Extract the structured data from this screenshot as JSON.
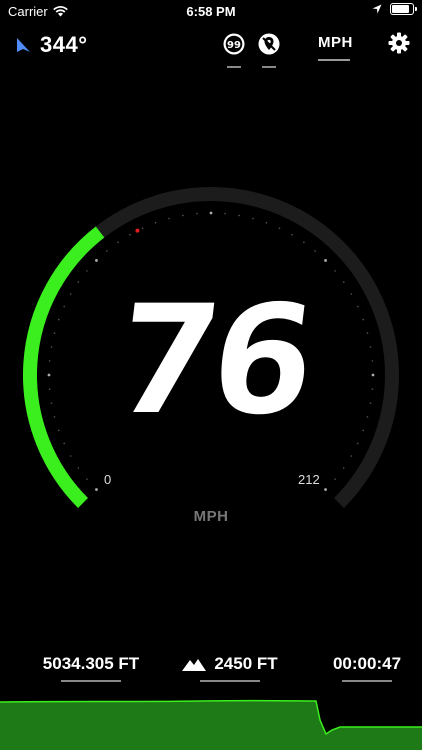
{
  "status_bar": {
    "carrier": "Carrier",
    "time": "6:58 PM",
    "battery_level": 0.9
  },
  "header": {
    "heading_value": "344°",
    "heading_icon": "navigation-arrow-icon",
    "speed_limit_icon": "speed-limit-icon",
    "location_off_icon": "location-off-icon",
    "unit_label": "MPH",
    "settings_icon": "gear-icon"
  },
  "gauge": {
    "speed": "76",
    "min_label": "0",
    "max_label": "212",
    "unit": "MPH",
    "speed_fraction": 0.36,
    "colors": {
      "active_arc": "#3bee1e",
      "track": "#1c1c1c",
      "max_marker": "#e02020"
    }
  },
  "stats": {
    "distance": "5034.305 FT",
    "altitude": "2450 FT",
    "altitude_icon": "mountain-icon",
    "duration": "00:00:47"
  },
  "elevation_graph": {
    "fill_color": "#1e7a16",
    "line_color": "#3bee1e"
  }
}
